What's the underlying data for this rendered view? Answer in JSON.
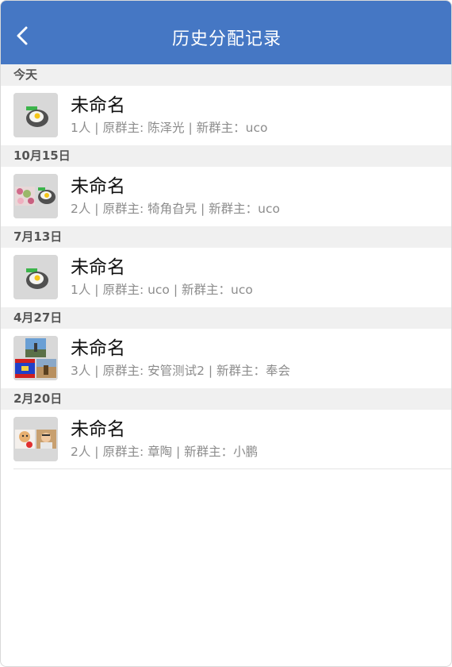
{
  "header": {
    "title": "历史分配记录",
    "back_icon": "chevron-left-icon"
  },
  "colors": {
    "header_bg": "#4577c4",
    "section_bg": "#f0f0f0",
    "secondary_text": "#8c8c8c"
  },
  "sections": [
    {
      "date": "今天",
      "items": [
        {
          "name": "未命名",
          "detail": "1人 | 原群主: 陈泽光 | 新群主：uco"
        }
      ]
    },
    {
      "date": "10月15日",
      "items": [
        {
          "name": "未命名",
          "detail": "2人 | 原群主: 犄角旮旯 | 新群主：uco"
        }
      ]
    },
    {
      "date": "7月13日",
      "items": [
        {
          "name": "未命名",
          "detail": "1人 | 原群主: uco | 新群主：uco"
        }
      ]
    },
    {
      "date": "4月27日",
      "items": [
        {
          "name": "未命名",
          "detail": "3人 | 原群主: 安管测试2 | 新群主：奉会"
        }
      ]
    },
    {
      "date": "2月20日",
      "items": [
        {
          "name": "未命名",
          "detail": "2人 | 原群主: 章陶 | 新群主：小鹏"
        }
      ]
    }
  ]
}
